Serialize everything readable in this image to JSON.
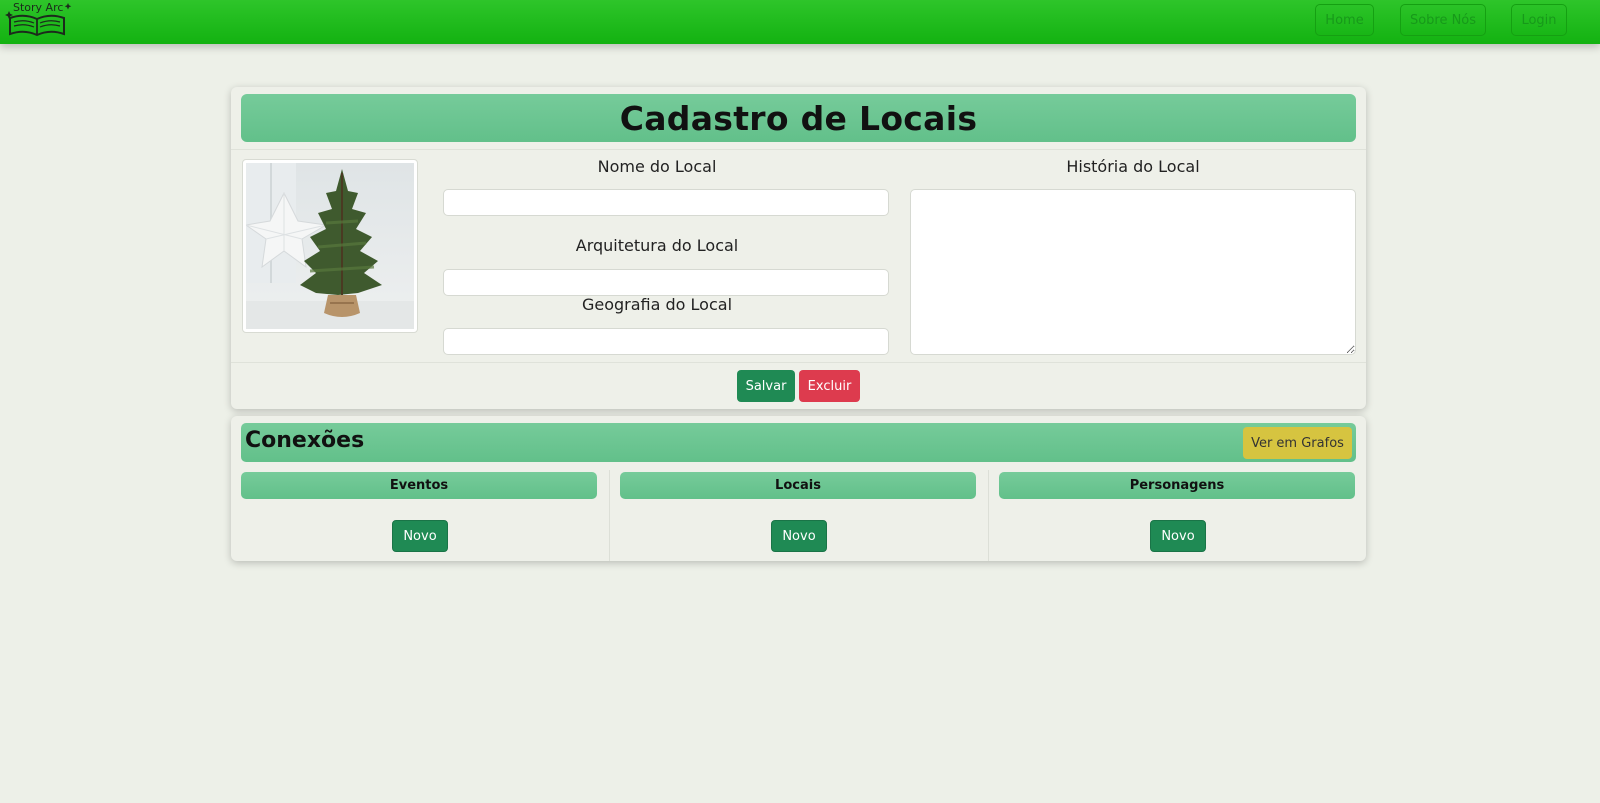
{
  "navbar": {
    "logo_text": "Story Arc",
    "links": [
      {
        "label": "Home"
      },
      {
        "label": "Sobre Nós"
      },
      {
        "label": "Login"
      }
    ]
  },
  "form": {
    "title": "Cadastro de Locais",
    "fields": {
      "nome": {
        "label": "Nome do Local",
        "value": ""
      },
      "arquitetura": {
        "label": "Arquitetura do Local",
        "value": ""
      },
      "geografia": {
        "label": "Geografia do Local",
        "value": ""
      },
      "historia": {
        "label": "História do Local",
        "value": ""
      }
    },
    "image_icon": "christmas-tree-photo",
    "save_label": "Salvar",
    "delete_label": "Excluir"
  },
  "connections": {
    "title": "Conexões",
    "graph_button_label": "Ver em Grafos",
    "columns": [
      {
        "header": "Eventos",
        "new_label": "Novo"
      },
      {
        "header": "Locais",
        "new_label": "Novo"
      },
      {
        "header": "Personagens",
        "new_label": "Novo"
      }
    ]
  },
  "colors": {
    "navbar": "#13b211",
    "header_green": "#6ac592",
    "save": "#1f8a54",
    "delete": "#dd3b4e",
    "graphs": "#d6c440",
    "background": "#edf0e8"
  }
}
